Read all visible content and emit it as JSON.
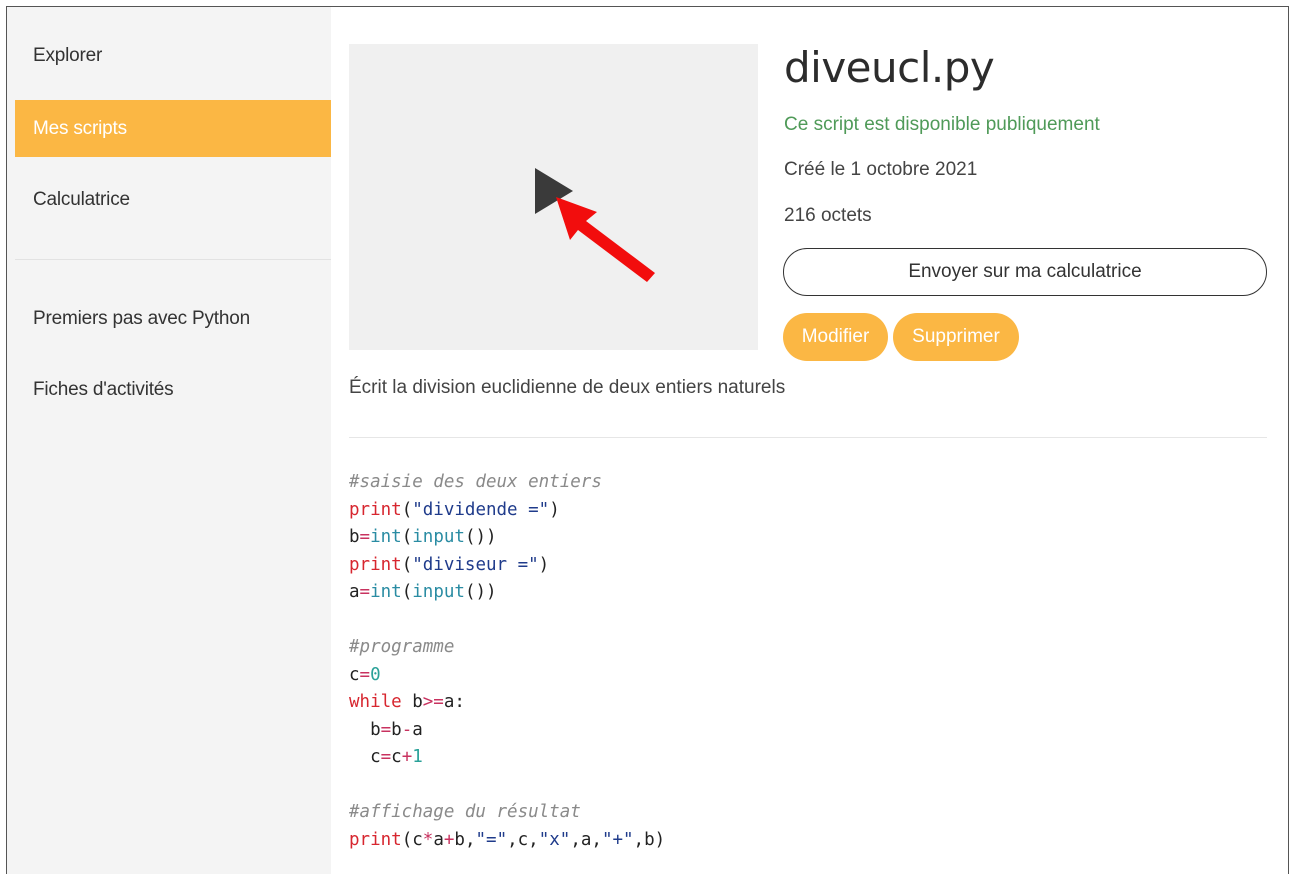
{
  "sidebar": {
    "items": [
      {
        "label": "Explorer",
        "active": false
      },
      {
        "label": "Mes scripts",
        "active": true
      },
      {
        "label": "Calculatrice",
        "active": false
      },
      {
        "label": "Premiers pas avec Python",
        "active": false
      },
      {
        "label": "Fiches d'activités",
        "active": false
      }
    ]
  },
  "script": {
    "title": "diveucl.py",
    "public_status": "Ce script est disponible publiquement",
    "created": "Créé le 1 octobre 2021",
    "size": "216 octets",
    "description": "Écrit la division euclidienne de deux entiers naturels"
  },
  "actions": {
    "send_label": "Envoyer sur ma calculatrice",
    "edit_label": "Modifier",
    "delete_label": "Supprimer"
  },
  "preview": {
    "play_icon": "play-icon",
    "annotation_icon": "red-arrow-icon"
  },
  "colors": {
    "accent": "#fbb744",
    "public_text": "#4f9a58",
    "annotation_arrow": "#f20d0d"
  },
  "code_lines": [
    [
      {
        "t": "#saisie des deux entiers",
        "k": "comment"
      }
    ],
    [
      {
        "t": "print",
        "k": "keyword"
      },
      {
        "t": "(",
        "k": "plain"
      },
      {
        "t": "\"dividende =\"",
        "k": "string"
      },
      {
        "t": ")",
        "k": "plain"
      }
    ],
    [
      {
        "t": "b",
        "k": "plain"
      },
      {
        "t": "=",
        "k": "operator"
      },
      {
        "t": "int",
        "k": "builtin"
      },
      {
        "t": "(",
        "k": "plain"
      },
      {
        "t": "input",
        "k": "builtin"
      },
      {
        "t": "())",
        "k": "plain"
      }
    ],
    [
      {
        "t": "print",
        "k": "keyword"
      },
      {
        "t": "(",
        "k": "plain"
      },
      {
        "t": "\"diviseur =\"",
        "k": "string"
      },
      {
        "t": ")",
        "k": "plain"
      }
    ],
    [
      {
        "t": "a",
        "k": "plain"
      },
      {
        "t": "=",
        "k": "operator"
      },
      {
        "t": "int",
        "k": "builtin"
      },
      {
        "t": "(",
        "k": "plain"
      },
      {
        "t": "input",
        "k": "builtin"
      },
      {
        "t": "())",
        "k": "plain"
      }
    ],
    [],
    [
      {
        "t": "#programme",
        "k": "comment"
      }
    ],
    [
      {
        "t": "c",
        "k": "plain"
      },
      {
        "t": "=",
        "k": "operator"
      },
      {
        "t": "0",
        "k": "number"
      }
    ],
    [
      {
        "t": "while",
        "k": "keyword"
      },
      {
        "t": " b",
        "k": "plain"
      },
      {
        "t": ">=",
        "k": "operator"
      },
      {
        "t": "a:",
        "k": "plain"
      }
    ],
    [
      {
        "t": "  b",
        "k": "plain"
      },
      {
        "t": "=",
        "k": "operator"
      },
      {
        "t": "b",
        "k": "plain"
      },
      {
        "t": "-",
        "k": "operator"
      },
      {
        "t": "a",
        "k": "plain"
      }
    ],
    [
      {
        "t": "  c",
        "k": "plain"
      },
      {
        "t": "=",
        "k": "operator"
      },
      {
        "t": "c",
        "k": "plain"
      },
      {
        "t": "+",
        "k": "operator"
      },
      {
        "t": "1",
        "k": "number"
      }
    ],
    [],
    [
      {
        "t": "#affichage du résultat",
        "k": "comment"
      }
    ],
    [
      {
        "t": "print",
        "k": "keyword"
      },
      {
        "t": "(",
        "k": "plain"
      },
      {
        "t": "c",
        "k": "plain"
      },
      {
        "t": "*",
        "k": "operator"
      },
      {
        "t": "a",
        "k": "plain"
      },
      {
        "t": "+",
        "k": "operator"
      },
      {
        "t": "b,",
        "k": "plain"
      },
      {
        "t": "\"=\"",
        "k": "string"
      },
      {
        "t": ",c,",
        "k": "plain"
      },
      {
        "t": "\"x\"",
        "k": "string"
      },
      {
        "t": ",a,",
        "k": "plain"
      },
      {
        "t": "\"+\"",
        "k": "string"
      },
      {
        "t": ",b)",
        "k": "plain"
      }
    ]
  ]
}
